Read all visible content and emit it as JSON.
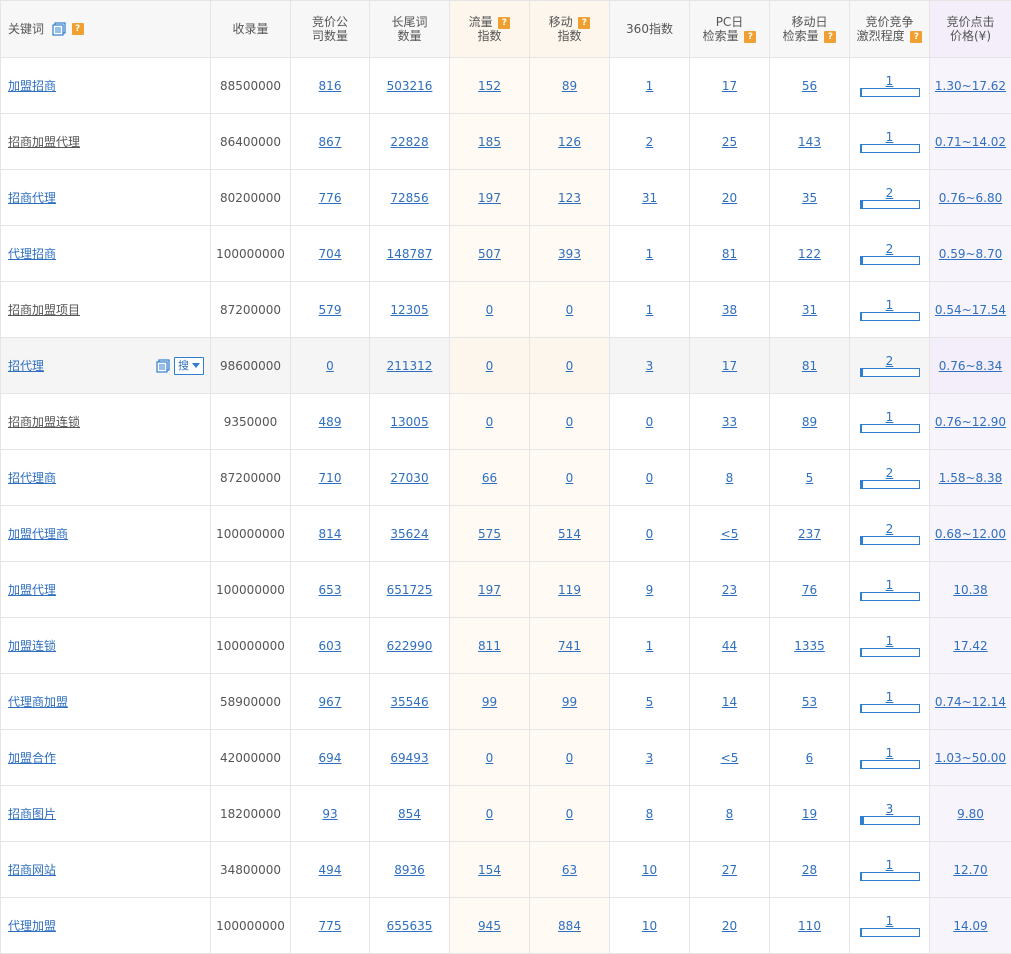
{
  "headers": {
    "keyword": "关键词",
    "indexed": "收录量",
    "companies": "竞价公司数量",
    "longtail": "长尾词数量",
    "flow": "流量指数",
    "mobile": "移动指数",
    "idx360": "360指数",
    "pc": "PC日检索量",
    "mob_daily": "移动日检索量",
    "competition": "竞价竞争激烈程度",
    "price": "竞价点击价格(¥)"
  },
  "headers_split": {
    "companies": [
      "竞价公",
      "司数量"
    ],
    "longtail": [
      "长尾词",
      "数量"
    ],
    "flow": [
      "流量",
      "指数"
    ],
    "mobile": [
      "移动",
      "指数"
    ],
    "pc": [
      "PC日",
      "检索量"
    ],
    "mob_daily": [
      "移动日",
      "检索量"
    ],
    "competition": [
      "竞价竞争",
      "激烈程度"
    ],
    "price": [
      "竞价点击",
      "价格(¥)"
    ]
  },
  "sou_label": "搜",
  "rows": [
    {
      "kw": "加盟招商",
      "gray": false,
      "indexed": "88500000",
      "companies": "816",
      "longtail": "503216",
      "flow": "152",
      "mobile": "89",
      "idx360": "1",
      "pc": "17",
      "mob_daily": "56",
      "comp": "1",
      "comp_level": 0.2,
      "price": "1.30~17.62"
    },
    {
      "kw": "招商加盟代理",
      "gray": true,
      "indexed": "86400000",
      "companies": "867",
      "longtail": "22828",
      "flow": "185",
      "mobile": "126",
      "idx360": "2",
      "pc": "25",
      "mob_daily": "143",
      "comp": "1",
      "comp_level": 0.2,
      "price": "0.71~14.02"
    },
    {
      "kw": "招商代理",
      "gray": false,
      "indexed": "80200000",
      "companies": "776",
      "longtail": "72856",
      "flow": "197",
      "mobile": "123",
      "idx360": "31",
      "pc": "20",
      "mob_daily": "35",
      "comp": "2",
      "comp_level": 0.4,
      "price": "0.76~6.80"
    },
    {
      "kw": "代理招商",
      "gray": false,
      "indexed": "100000000",
      "companies": "704",
      "longtail": "148787",
      "flow": "507",
      "mobile": "393",
      "idx360": "1",
      "pc": "81",
      "mob_daily": "122",
      "comp": "2",
      "comp_level": 0.4,
      "price": "0.59~8.70"
    },
    {
      "kw": "招商加盟项目",
      "gray": true,
      "indexed": "87200000",
      "companies": "579",
      "longtail": "12305",
      "flow": "0",
      "mobile": "0",
      "idx360": "1",
      "pc": "38",
      "mob_daily": "31",
      "comp": "1",
      "comp_level": 0.2,
      "price": "0.54~17.54"
    },
    {
      "kw": "招代理",
      "gray": false,
      "indexed": "98600000",
      "companies": "0",
      "longtail": "211312",
      "flow": "0",
      "mobile": "0",
      "idx360": "3",
      "pc": "17",
      "mob_daily": "81",
      "comp": "2",
      "comp_level": 0.4,
      "price": "0.76~8.34",
      "highlight": true
    },
    {
      "kw": "招商加盟连锁",
      "gray": true,
      "indexed": "9350000",
      "companies": "489",
      "longtail": "13005",
      "flow": "0",
      "mobile": "0",
      "idx360": "0",
      "pc": "33",
      "mob_daily": "89",
      "comp": "1",
      "comp_level": 0.2,
      "price": "0.76~12.90"
    },
    {
      "kw": "招代理商",
      "gray": false,
      "indexed": "87200000",
      "companies": "710",
      "longtail": "27030",
      "flow": "66",
      "mobile": "0",
      "idx360": "0",
      "pc": "8",
      "mob_daily": "5",
      "comp": "2",
      "comp_level": 0.4,
      "price": "1.58~8.38"
    },
    {
      "kw": "加盟代理商",
      "gray": false,
      "indexed": "100000000",
      "companies": "814",
      "longtail": "35624",
      "flow": "575",
      "mobile": "514",
      "idx360": "0",
      "pc": "<5",
      "mob_daily": "237",
      "comp": "2",
      "comp_level": 0.4,
      "price": "0.68~12.00"
    },
    {
      "kw": "加盟代理",
      "gray": false,
      "indexed": "100000000",
      "companies": "653",
      "longtail": "651725",
      "flow": "197",
      "mobile": "119",
      "idx360": "9",
      "pc": "23",
      "mob_daily": "76",
      "comp": "1",
      "comp_level": 0.2,
      "price": "10.38"
    },
    {
      "kw": "加盟连锁",
      "gray": false,
      "indexed": "100000000",
      "companies": "603",
      "longtail": "622990",
      "flow": "811",
      "mobile": "741",
      "idx360": "1",
      "pc": "44",
      "mob_daily": "1335",
      "comp": "1",
      "comp_level": 0.2,
      "price": "17.42"
    },
    {
      "kw": "代理商加盟",
      "gray": false,
      "indexed": "58900000",
      "companies": "967",
      "longtail": "35546",
      "flow": "99",
      "mobile": "99",
      "idx360": "5",
      "pc": "14",
      "mob_daily": "53",
      "comp": "1",
      "comp_level": 0.2,
      "price": "0.74~12.14"
    },
    {
      "kw": "加盟合作",
      "gray": false,
      "indexed": "42000000",
      "companies": "694",
      "longtail": "69493",
      "flow": "0",
      "mobile": "0",
      "idx360": "3",
      "pc": "<5",
      "mob_daily": "6",
      "comp": "1",
      "comp_level": 0.2,
      "price": "1.03~50.00"
    },
    {
      "kw": "招商图片",
      "gray": false,
      "indexed": "18200000",
      "companies": "93",
      "longtail": "854",
      "flow": "0",
      "mobile": "0",
      "idx360": "8",
      "pc": "8",
      "mob_daily": "19",
      "comp": "3",
      "comp_level": 0.6,
      "price": "9.80"
    },
    {
      "kw": "招商网站",
      "gray": false,
      "indexed": "34800000",
      "companies": "494",
      "longtail": "8936",
      "flow": "154",
      "mobile": "63",
      "idx360": "10",
      "pc": "27",
      "mob_daily": "28",
      "comp": "1",
      "comp_level": 0.2,
      "price": "12.70"
    },
    {
      "kw": "代理加盟",
      "gray": false,
      "indexed": "100000000",
      "companies": "775",
      "longtail": "655635",
      "flow": "945",
      "mobile": "884",
      "idx360": "10",
      "pc": "20",
      "mob_daily": "110",
      "comp": "1",
      "comp_level": 0.2,
      "price": "14.09"
    }
  ]
}
